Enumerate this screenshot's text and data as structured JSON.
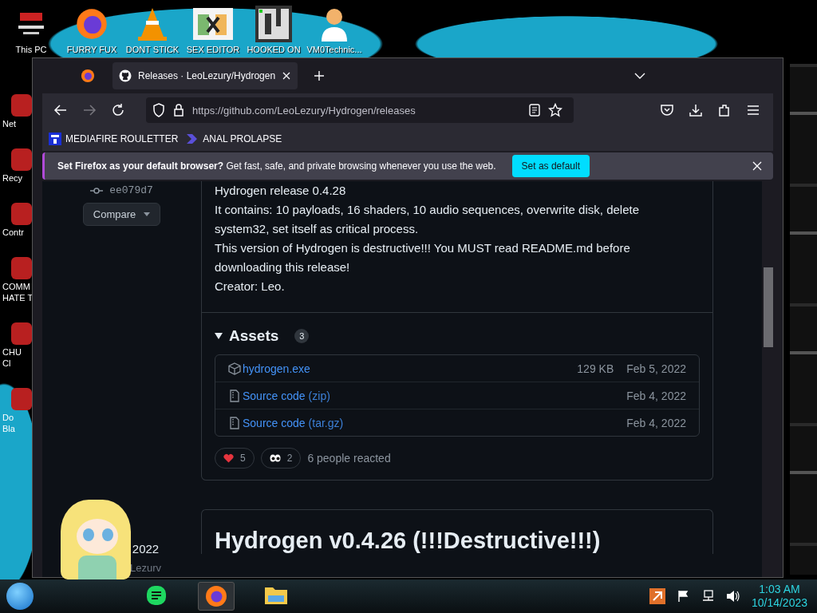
{
  "desktop_icons": [
    {
      "label": "This PC",
      "kind": "pc"
    },
    {
      "label": "FURRY FUX",
      "kind": "firefox"
    },
    {
      "label": "DONT STICK",
      "kind": "cone"
    },
    {
      "label": "SEX EDITOR",
      "kind": "hex"
    },
    {
      "label": "HOOKED ON",
      "kind": "maze"
    },
    {
      "label": "VM0Technic...",
      "kind": "doctor"
    }
  ],
  "side_icons": [
    {
      "lines": [
        "Net"
      ]
    },
    {
      "lines": [
        "Recy"
      ]
    },
    {
      "lines": [
        "Contr"
      ]
    },
    {
      "lines": [
        "COMM",
        "HATE T"
      ]
    },
    {
      "lines": [
        "CHU",
        "Cl"
      ]
    },
    {
      "lines": [
        "Do",
        "Bla"
      ]
    }
  ],
  "browser": {
    "tab": {
      "title": "Releases · LeoLezury/Hydrogen",
      "selected": true
    },
    "url": "https://github.com/LeoLezury/Hydrogen/releases",
    "bookmarks": [
      {
        "label": "MEDIAFIRE ROULETTER",
        "kind": "mft"
      },
      {
        "label": "ANAL PROLAPSE",
        "kind": "arrow"
      }
    ],
    "notification": {
      "text": "**Set Firefox as your default browser?** Get fast, safe, and private browsing whenever you use the web.",
      "button": "Set as default"
    }
  },
  "sidebar": {
    "commit": "ee079d7",
    "compare": "Compare",
    "date": "2022",
    "author": "Lezurv"
  },
  "release": {
    "body": [
      "Hydrogen release 0.4.28",
      "It contains: 10 payloads, 16 shaders, 10 audio sequences, overwrite disk, delete system32, set itself as critical process.",
      "This version of Hydrogen is destructive!!! You MUST read README.md before downloading this release!",
      "Creator: Leo."
    ],
    "assets": {
      "title": "Assets",
      "count": "3",
      "expanded": true,
      "items": [
        {
          "kind": "package",
          "name": "hydrogen.exe",
          "size": "129 KB",
          "date": "Feb 5, 2022"
        },
        {
          "kind": "archive",
          "name": "Source code",
          "suffix": "(zip)",
          "date": "Feb 4, 2022"
        },
        {
          "kind": "archive",
          "name": "Source code",
          "suffix": "(tar.gz)",
          "date": "Feb 4, 2022"
        }
      ]
    },
    "reactions": [
      {
        "kind": "heart",
        "count": "5"
      },
      {
        "kind": "eyes",
        "count": "2"
      }
    ],
    "reaction_summary": "6 people reacted"
  },
  "next_release": {
    "title": "Hydrogen v0.4.26 (!!!Destructive!!!)"
  },
  "taskbar": {
    "apps": [
      {
        "kind": "chat",
        "selected": false
      },
      {
        "kind": "firefox",
        "selected": true
      },
      {
        "kind": "folder",
        "selected": false
      }
    ],
    "time": "1:03 AM",
    "date": "10/14/2023"
  }
}
